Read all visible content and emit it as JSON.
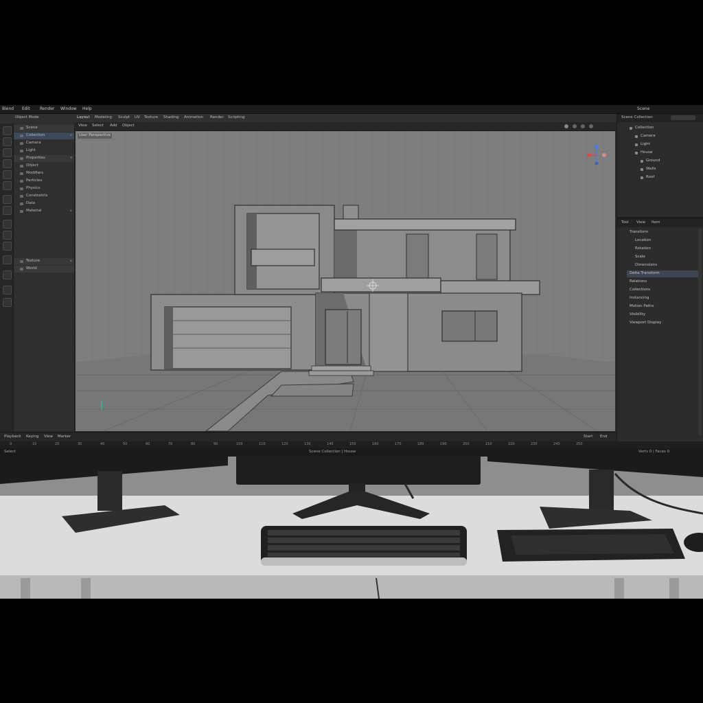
{
  "menubar": {
    "items": [
      "Blend",
      "Edit",
      "Render",
      "Window",
      "Help"
    ],
    "active_object": "Scene"
  },
  "workspace_tabs": [
    "Layout",
    "Modeling",
    "Sculpt",
    "UV",
    "Texture",
    "Shading",
    "Animation",
    "Render",
    "Scripting"
  ],
  "viewport": {
    "mode_label": "Object Mode",
    "menus": [
      "View",
      "Select",
      "Add",
      "Object"
    ],
    "overlay_label": "User Perspective"
  },
  "left_panel": {
    "items": [
      {
        "label": "Scene"
      },
      {
        "label": "Collection"
      },
      {
        "label": "Camera"
      },
      {
        "label": "Light"
      },
      {
        "label": "Properties"
      },
      {
        "label": "Object"
      },
      {
        "label": "Modifiers"
      },
      {
        "label": "Particles"
      },
      {
        "label": "Physics"
      },
      {
        "label": "Constraints"
      },
      {
        "label": "Data"
      },
      {
        "label": "Material"
      },
      {
        "label": "Texture"
      },
      {
        "label": "World"
      }
    ]
  },
  "outliner": {
    "title": "Scene Collection",
    "items": [
      {
        "label": "Collection"
      },
      {
        "label": "Camera"
      },
      {
        "label": "Light"
      },
      {
        "label": "House"
      },
      {
        "label": "Ground"
      },
      {
        "label": "Walls"
      },
      {
        "label": "Roof"
      }
    ]
  },
  "properties": {
    "tabs": [
      "Tool",
      "View",
      "Item"
    ],
    "items": [
      {
        "label": "Transform"
      },
      {
        "label": "Location"
      },
      {
        "label": "Rotation"
      },
      {
        "label": "Scale"
      },
      {
        "label": "Dimensions"
      },
      {
        "label": "Delta Transform"
      },
      {
        "label": "Relations"
      },
      {
        "label": "Collections"
      },
      {
        "label": "Instancing"
      },
      {
        "label": "Motion Paths"
      },
      {
        "label": "Visibility"
      },
      {
        "label": "Viewport Display"
      }
    ]
  },
  "timeline": {
    "menus": [
      "Playback",
      "Keying",
      "View",
      "Marker"
    ],
    "frame_ticks": [
      "0",
      "10",
      "20",
      "30",
      "40",
      "50",
      "60",
      "70",
      "80",
      "90",
      "100",
      "110",
      "120",
      "130",
      "140",
      "150",
      "160",
      "170",
      "180",
      "190",
      "200",
      "210",
      "220",
      "230",
      "240",
      "250"
    ],
    "start_label": "Start",
    "end_label": "End"
  },
  "statusbar": {
    "left": "Select",
    "center": "Scene Collection | House",
    "right": "Verts 0 | Faces 0"
  },
  "colors": {
    "accent": "#3c4a5c",
    "viewport_bg": "#7d7d7d",
    "ui_bg": "#2b2b2b",
    "gizmo_x": "#d94a4a",
    "gizmo_y": "#5faf52",
    "gizmo_z": "#4a7fd9"
  }
}
